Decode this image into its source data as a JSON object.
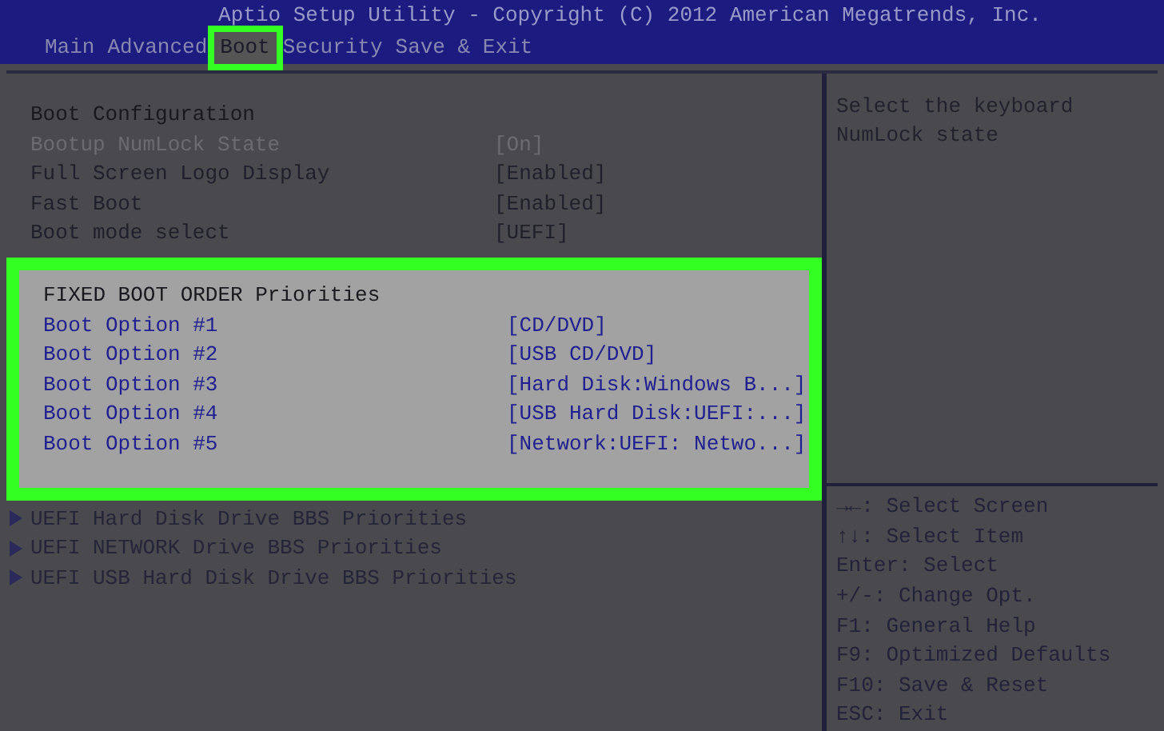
{
  "window": {
    "title": "Aptio Setup Utility - Copyright (C) 2012 American Megatrends, Inc."
  },
  "tabs": [
    {
      "label": "Main",
      "selected": false,
      "highlighted": false
    },
    {
      "label": "Advanced",
      "selected": false,
      "highlighted": false
    },
    {
      "label": "Boot",
      "selected": true,
      "highlighted": true
    },
    {
      "label": "Security",
      "selected": false,
      "highlighted": false
    },
    {
      "label": "Save & Exit",
      "selected": false,
      "highlighted": false
    }
  ],
  "settings": [
    {
      "kind": "header",
      "label": "Boot Configuration"
    },
    {
      "kind": "setting",
      "label": "Bootup NumLock State",
      "value": "[On]",
      "disabled": true
    },
    {
      "kind": "setting",
      "label": "Full Screen Logo Display",
      "value": "[Enabled]",
      "disabled": false
    },
    {
      "kind": "setting",
      "label": "Fast Boot",
      "value": "[Enabled]",
      "disabled": false
    },
    {
      "kind": "setting",
      "label": "Boot mode select",
      "value": "[UEFI]",
      "disabled": false
    }
  ],
  "boot_order": {
    "highlighted": true,
    "title": "FIXED BOOT ORDER Priorities",
    "options": [
      {
        "label": "Boot Option #1",
        "value": "[CD/DVD]"
      },
      {
        "label": "Boot Option #2",
        "value": "[USB CD/DVD]"
      },
      {
        "label": "Boot Option #3",
        "value": "[Hard Disk:Windows B...]"
      },
      {
        "label": "Boot Option #4",
        "value": "[USB Hard Disk:UEFI:...]"
      },
      {
        "label": "Boot Option #5",
        "value": "[Network:UEFI: Netwo...]"
      }
    ]
  },
  "submenus": [
    {
      "label": "UEFI Hard Disk Drive BBS Priorities"
    },
    {
      "label": "UEFI NETWORK Drive BBS Priorities"
    },
    {
      "label": "UEFI USB Hard Disk Drive BBS Priorities"
    }
  ],
  "help": {
    "text": "Select the keyboard NumLock state"
  },
  "keys": [
    "→←: Select Screen",
    "↑↓: Select Item",
    "Enter: Select",
    "+/-: Change Opt.",
    "F1: General Help",
    "F9: Optimized Defaults",
    "F10: Save & Reset",
    "ESC: Exit"
  ]
}
